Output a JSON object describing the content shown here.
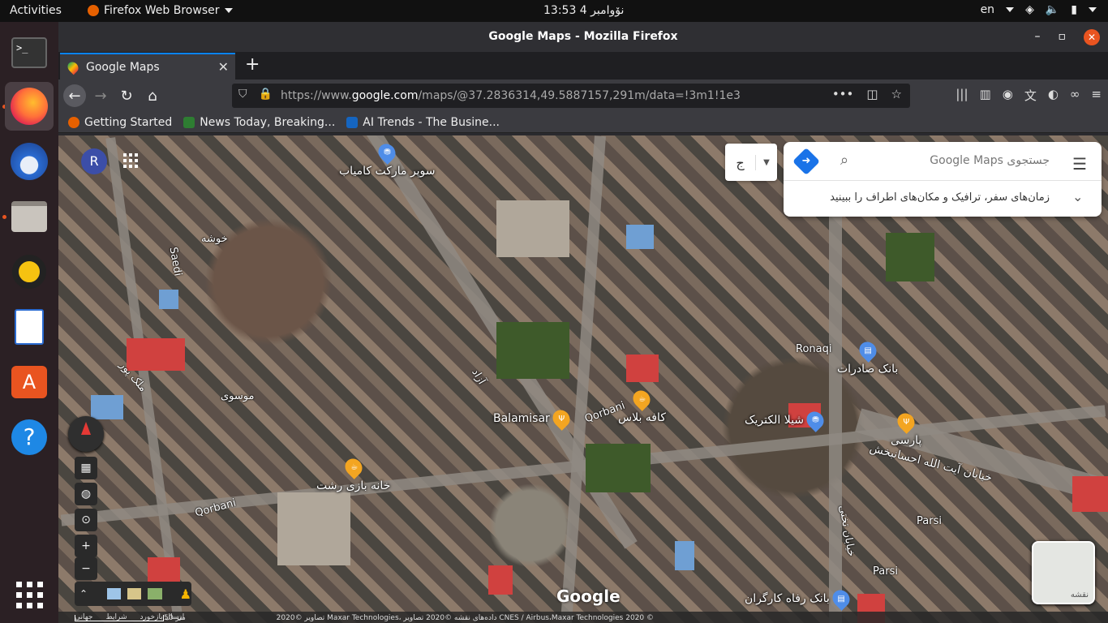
{
  "topbar": {
    "activities": "Activities",
    "app_name": "Firefox Web Browser",
    "clock": "13:53  4 نۆوامبر",
    "lang": "en"
  },
  "window": {
    "title": "Google Maps - Mozilla Firefox"
  },
  "tab": {
    "label": "Google Maps"
  },
  "urlbar": {
    "prefix": "https://www.",
    "domain": "google.com",
    "path": "/maps/@37.2836314,49.5887157,291m/data=!3m1!1e3"
  },
  "bookmarks": [
    {
      "label": "Getting Started",
      "color": "#e66000"
    },
    {
      "label": "News Today, Breaking...",
      "color": "#2e7d32"
    },
    {
      "label": "AI Trends - The Busine...",
      "color": "#1565c0"
    }
  ],
  "map": {
    "avatar_letter": "R",
    "search_placeholder": "جستجوی Google Maps",
    "search_hint": "زمان‌های سفر، ترافیک و مکان‌های اطراف را ببینید",
    "lang_button": "ج",
    "logo": "Google",
    "sat_thumb_label": "نقشه",
    "scale": "50 متر",
    "footer_links": [
      "ارسال بازخورد",
      "شرایط",
      "جهانی"
    ],
    "footer_copy": "تصاویر ©2020 Maxar Technologies، داده‌های نقشه ©2020 تصاویر CNES / Airbus،Maxar Technologies  2020 ©",
    "labels": [
      {
        "text": "سوپر مارکت کامیاب"
      },
      {
        "text": "Balamisar"
      },
      {
        "text": "کافه بلاس"
      },
      {
        "text": "شیلا الکتریک"
      },
      {
        "text": "بانک صادرات"
      },
      {
        "text": "پارسی"
      },
      {
        "text": "خانه بازی رشت"
      },
      {
        "text": "بانک رفاه کارگران"
      },
      {
        "text": "Ronaqi"
      },
      {
        "text": "Qorbani"
      },
      {
        "text": "Parsi"
      },
      {
        "text": "خیابان آیت الله احسانبخش"
      },
      {
        "text": "خیابان تختی"
      },
      {
        "text": "موسوی"
      },
      {
        "text": "خوشه"
      },
      {
        "text": "Saedi"
      },
      {
        "text": "ملک پور"
      },
      {
        "text": "آزاد"
      }
    ]
  }
}
